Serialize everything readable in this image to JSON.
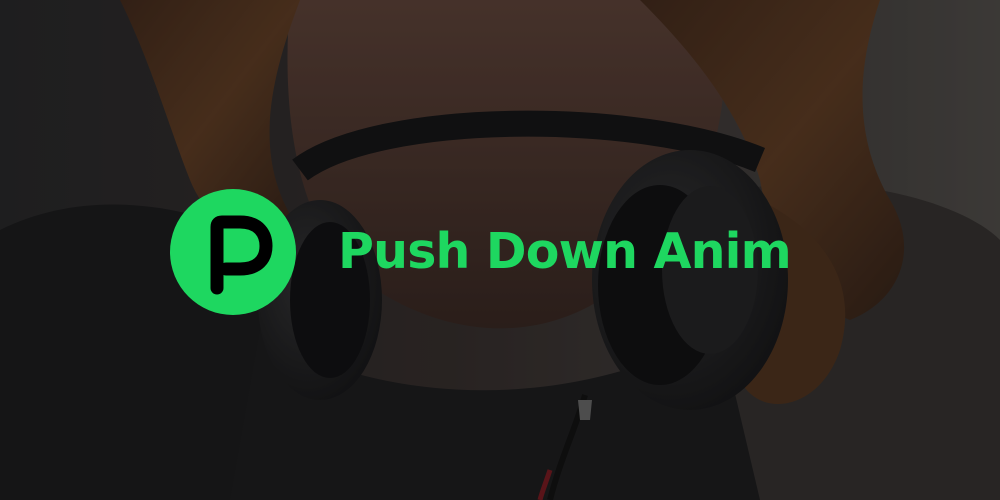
{
  "banner": {
    "title": "Push Down Anim",
    "logo_icon": "p-logo-icon",
    "background_image": "woman-with-headphones-photo"
  },
  "colors": {
    "accent": "#1ed760",
    "overlay": "#0a0a0a"
  }
}
